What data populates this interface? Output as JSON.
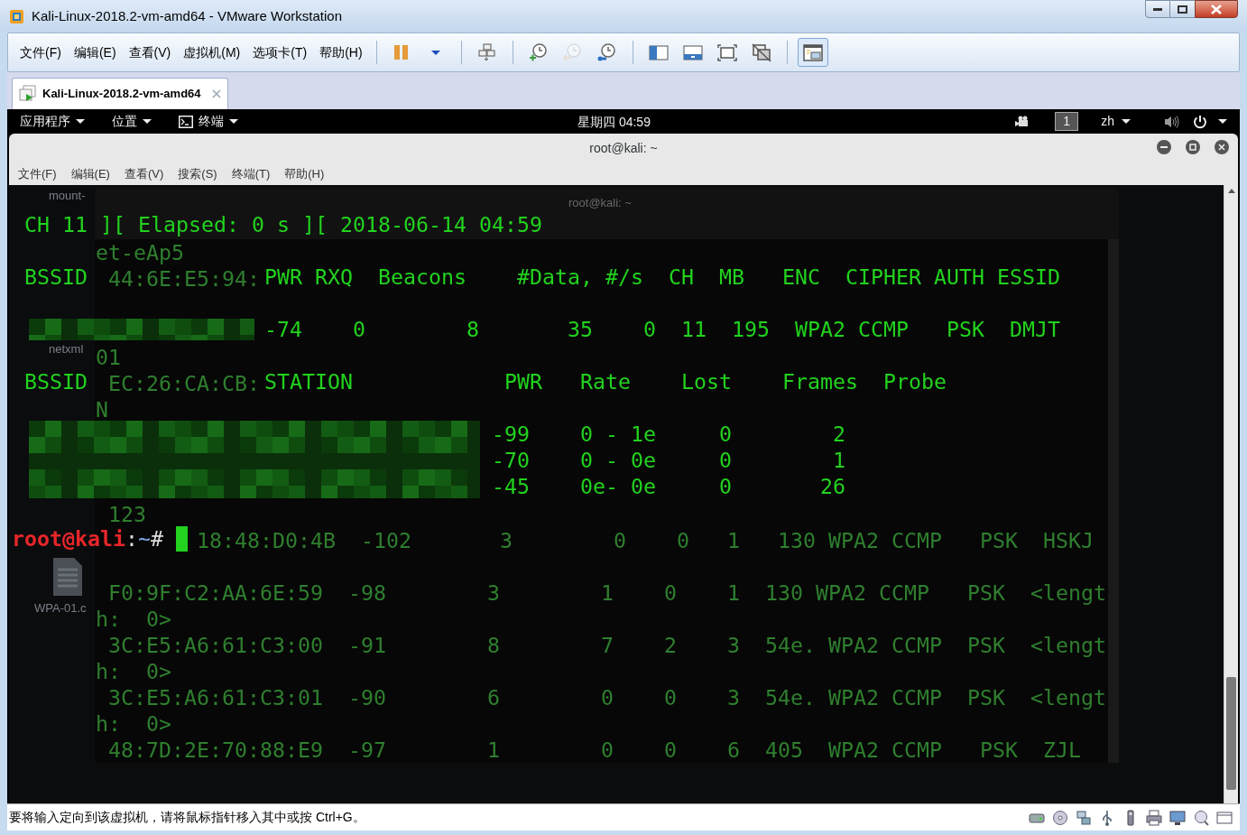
{
  "window": {
    "title": "Kali-Linux-2018.2-vm-amd64 - VMware Workstation"
  },
  "menu": [
    "文件(F)",
    "编辑(E)",
    "查看(V)",
    "虚拟机(M)",
    "选项卡(T)",
    "帮助(H)"
  ],
  "toolbar": [
    {
      "kind": "pause",
      "disabled": false,
      "pressed": false
    },
    {
      "kind": "dropdown",
      "disabled": false,
      "pressed": false
    },
    {
      "kind": "separator"
    },
    {
      "kind": "send-keys",
      "disabled": false,
      "pressed": false
    },
    {
      "kind": "separator"
    },
    {
      "kind": "snapshot-take",
      "disabled": false,
      "pressed": false
    },
    {
      "kind": "snapshot-revert",
      "disabled": true,
      "pressed": false
    },
    {
      "kind": "snapshot-manager",
      "disabled": false,
      "pressed": false
    },
    {
      "kind": "separator"
    },
    {
      "kind": "library",
      "disabled": false,
      "pressed": false
    },
    {
      "kind": "console",
      "disabled": false,
      "pressed": false
    },
    {
      "kind": "fullscreen",
      "disabled": false,
      "pressed": false
    },
    {
      "kind": "no-console",
      "disabled": false,
      "pressed": false
    },
    {
      "kind": "separator"
    },
    {
      "kind": "unity",
      "disabled": false,
      "pressed": true
    }
  ],
  "tabs": [
    {
      "label": "Kali-Linux-2018.2-vm-amd64",
      "selected": true
    }
  ],
  "guest_top_bar": {
    "menus": [
      {
        "label": "应用程序",
        "kind": "plain"
      },
      {
        "label": "位置",
        "kind": "plain"
      },
      {
        "label": "终端",
        "kind": "terminal"
      }
    ],
    "clock": "星期四 04:59",
    "workspace": "1",
    "input_method": "zh"
  },
  "desktop_icons": [
    {
      "label": "mount-"
    },
    {
      "label": "netxml"
    },
    {
      "label": "WPA-01.c"
    }
  ],
  "background_terminal": {
    "title": "root@kali: ~",
    "lines": [
      {
        "kind": "text",
        "text": "et-eAp5"
      },
      {
        "kind": "text",
        "text": " 44:6E:E5:94:"
      },
      {
        "kind": "blank"
      },
      {
        "kind": "blank"
      },
      {
        "kind": "text",
        "text": "01"
      },
      {
        "kind": "text",
        "text": " EC:26:CA:CB:"
      },
      {
        "kind": "text",
        "text": "N"
      },
      {
        "kind": "blank"
      },
      {
        "kind": "blank"
      },
      {
        "kind": "blank"
      },
      {
        "kind": "text",
        "text": " 123"
      },
      {
        "kind": "text",
        "text": "        18:48:D0:4B  -102       3        0    0   1   130 WPA2 CCMP   PSK  HSKJ"
      },
      {
        "kind": "blank"
      },
      {
        "kind": "text",
        "text": " F0:9F:C2:AA:6E:59  -98        3        1    0    1  130 WPA2 CCMP   PSK  <lengt"
      },
      {
        "kind": "text",
        "text": "h:  0>"
      },
      {
        "kind": "text",
        "text": " 3C:E5:A6:61:C3:00  -91        8        7    2    3  54e. WPA2 CCMP  PSK  <lengt"
      },
      {
        "kind": "text",
        "text": "h:  0>"
      },
      {
        "kind": "text",
        "text": " 3C:E5:A6:61:C3:01  -90        6        0    0    3  54e. WPA2 CCMP  PSK  <lengt"
      },
      {
        "kind": "text",
        "text": "h:  0>"
      },
      {
        "kind": "text",
        "text": " 48:7D:2E:70:88:E9  -97        1        0    0    6  405  WPA2 CCMP   PSK  ZJL"
      }
    ]
  },
  "terminal": {
    "title": "root@kali: ~",
    "menu": [
      "文件(F)",
      "编辑(E)",
      "查看(V)",
      "搜索(S)",
      "终端(T)",
      "帮助(H)"
    ],
    "lines": [
      {
        "kind": "blank"
      },
      {
        "kind": "text",
        "text": " CH 11 ][ Elapsed: 0 s ][ 2018-06-14 04:59"
      },
      {
        "kind": "blank"
      },
      {
        "kind": "text",
        "text": " BSSID              PWR RXQ  Beacons    #Data, #/s  CH  MB   ENC  CIPHER AUTH ESSID"
      },
      {
        "kind": "blank"
      },
      {
        "kind": "redacted",
        "text": "                    -74    0        8       35    0  11  195  WPA2 CCMP   PSK  DMJT"
      },
      {
        "kind": "blank"
      },
      {
        "kind": "text",
        "text": " BSSID              STATION            PWR   Rate    Lost    Frames  Probe"
      },
      {
        "kind": "blank"
      },
      {
        "kind": "redacted",
        "text": "                                      -99    0 - 1e     0        2"
      },
      {
        "kind": "redacted",
        "text": "                                      -70    0 - 0e     0        1"
      },
      {
        "kind": "redacted",
        "text": "                                      -45    0e- 0e     0       26"
      },
      {
        "kind": "blank"
      },
      {
        "kind": "prompt",
        "user_host": "root@kali",
        "separator": ":",
        "path": "~",
        "symbol": "#"
      }
    ]
  },
  "status_bar": {
    "message": "要将输入定向到该虚拟机，请将鼠标指针移入其中或按 Ctrl+G。"
  }
}
